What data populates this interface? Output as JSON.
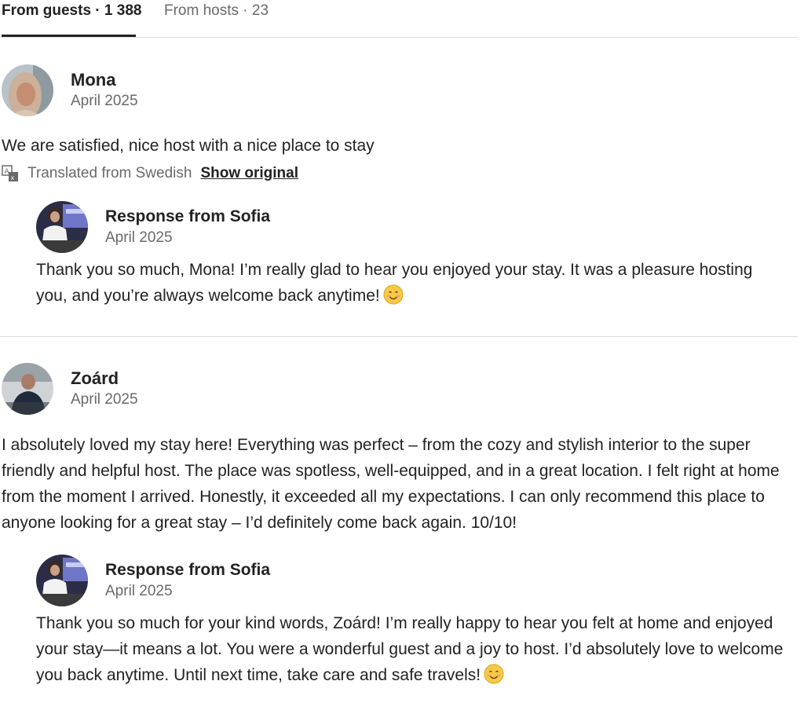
{
  "tabs": {
    "guests_label": "From guests · 1 388",
    "hosts_label": "From hosts · 23"
  },
  "reviews": [
    {
      "author": "Mona",
      "date": "April 2025",
      "text": "We are satisfied, nice host with a nice place to stay",
      "translated_label": "Translated from Swedish",
      "show_original_label": "Show original",
      "response": {
        "title": "Response from Sofia",
        "date": "April 2025",
        "text": "Thank you so much, Mona! I’m really glad to hear you enjoyed your stay. It was a pleasure hosting you, and you’re always welcome back anytime!"
      }
    },
    {
      "author": "Zoárd",
      "date": "April 2025",
      "text": "I absolutely loved my stay here! Everything was perfect – from the cozy and stylish interior to the super friendly and helpful host. The place was spotless, well-equipped, and in a great location. I felt right at home from the moment I arrived. Honestly, it exceeded all my expectations. I can only recommend this place to anyone looking for a great stay – I’d definitely come back again. 10/10!",
      "response": {
        "title": "Response from Sofia",
        "date": "April 2025",
        "text": "Thank you so much for your kind words, Zoárd! I’m really happy to hear you felt at home and enjoyed your stay—it means a lot. You were a wonderful guest and a joy to host. I’d absolutely love to welcome you back anytime. Until next time, take care and safe travels!"
      }
    }
  ],
  "icons": {
    "translate": "translate-icon",
    "emoji": "smiling-face-icon"
  },
  "colors": {
    "text": "#222222",
    "secondary_text": "#6a6a6a",
    "divider": "#dddddd"
  }
}
